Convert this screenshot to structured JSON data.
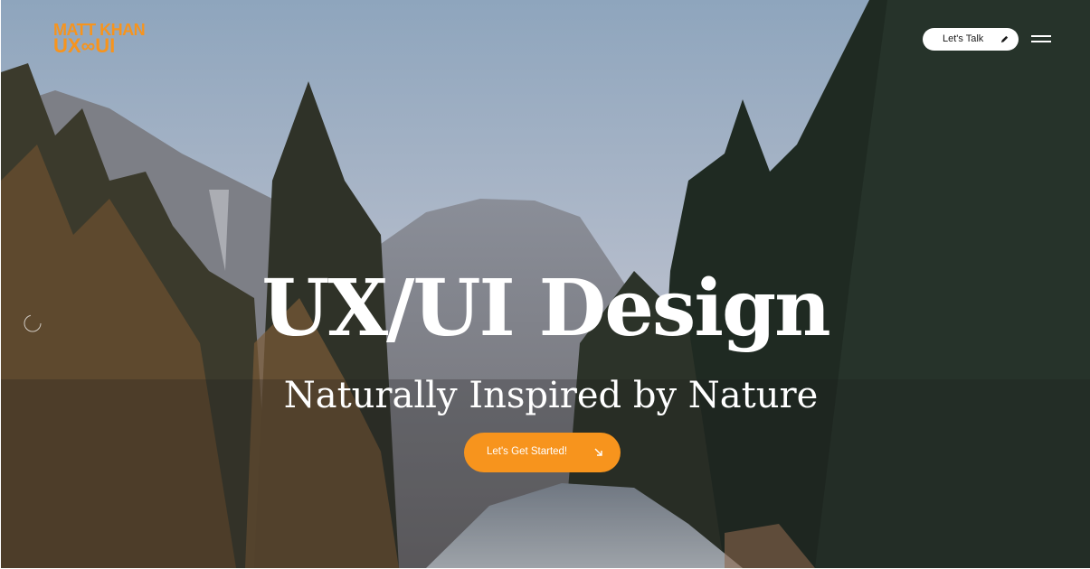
{
  "brand": {
    "line1": "MATT KHAN",
    "line2": "UX∞UI",
    "accent_color": "#f7941d"
  },
  "header": {
    "talk_button_label": "Let's Talk",
    "talk_button_icon": "pencil-icon",
    "menu_icon": "hamburger-menu-icon"
  },
  "hero": {
    "title": "UX/UI Design",
    "subtitle": "Naturally Inspired by Nature",
    "cta_label": "Let's Get Started!",
    "cta_icon": "arrow-down-right-icon",
    "background_description_icon": "forest-river-mountain-photo"
  }
}
